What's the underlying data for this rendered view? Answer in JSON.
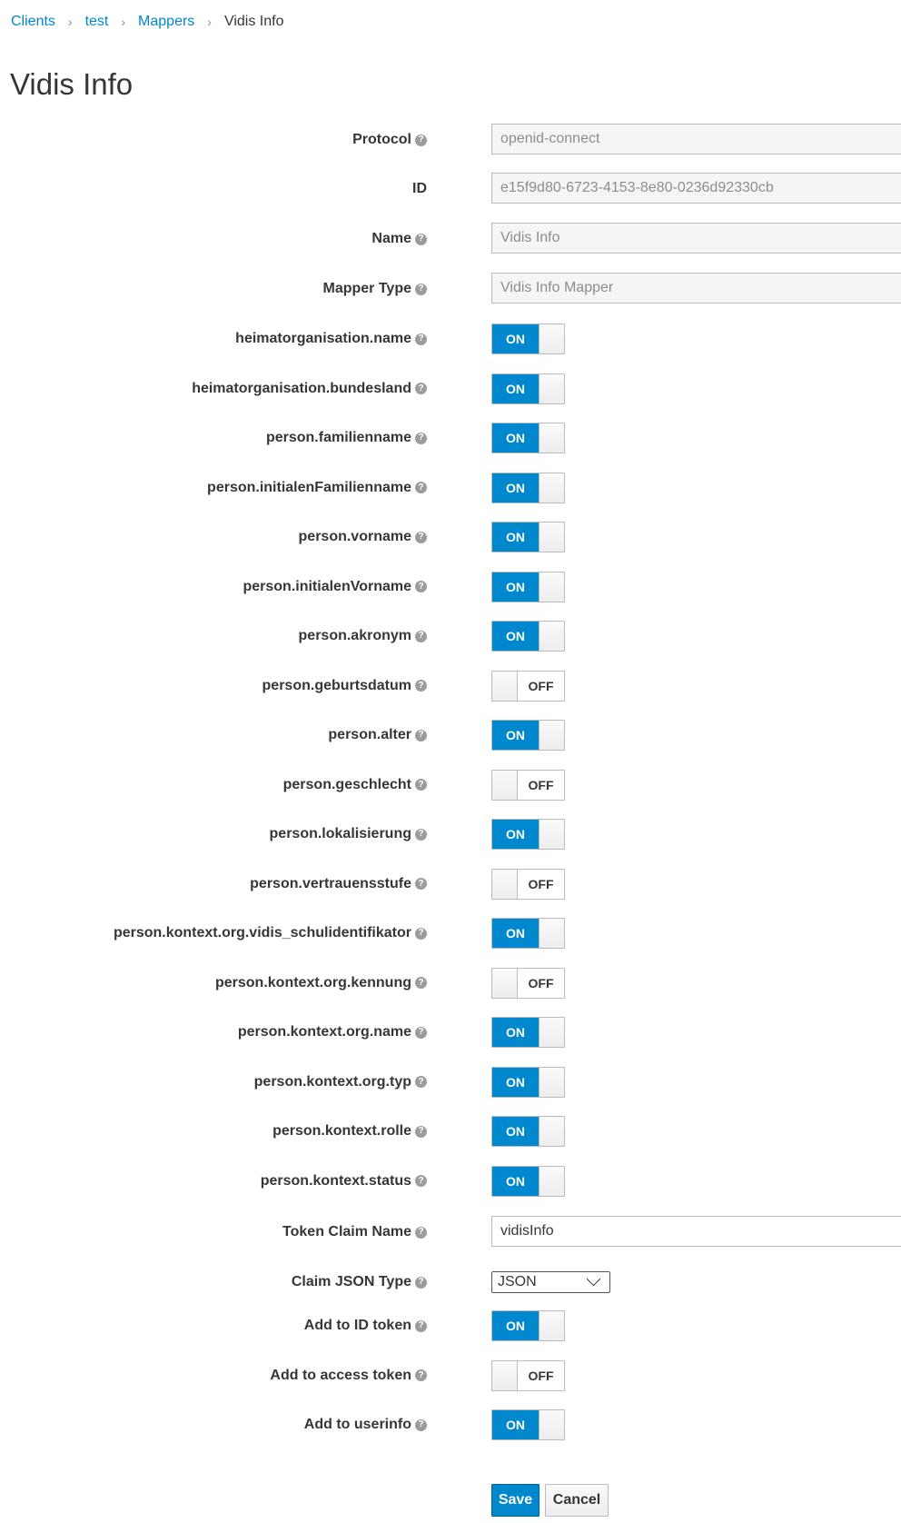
{
  "breadcrumb": {
    "clients": "Clients",
    "test": "test",
    "mappers": "Mappers",
    "current": "Vidis Info",
    "separator": "›"
  },
  "page_title": "Vidis Info",
  "help_glyph": "?",
  "fields": {
    "protocol": {
      "label": "Protocol",
      "value": "openid-connect"
    },
    "id": {
      "label": "ID",
      "value": "e15f9d80-6723-4153-8e80-0236d92330cb"
    },
    "name": {
      "label": "Name",
      "value": "Vidis Info"
    },
    "mapper_type": {
      "label": "Mapper Type",
      "value": "Vidis Info Mapper"
    },
    "token_claim_name": {
      "label": "Token Claim Name",
      "value": "vidisInfo"
    },
    "claim_json_type": {
      "label": "Claim JSON Type",
      "value": "JSON"
    }
  },
  "toggles": [
    {
      "label": "heimatorganisation.name",
      "state": "ON"
    },
    {
      "label": "heimatorganisation.bundesland",
      "state": "ON"
    },
    {
      "label": "person.familienname",
      "state": "ON"
    },
    {
      "label": "person.initialenFamilienname",
      "state": "ON"
    },
    {
      "label": "person.vorname",
      "state": "ON"
    },
    {
      "label": "person.initialenVorname",
      "state": "ON"
    },
    {
      "label": "person.akronym",
      "state": "ON"
    },
    {
      "label": "person.geburtsdatum",
      "state": "OFF"
    },
    {
      "label": "person.alter",
      "state": "ON"
    },
    {
      "label": "person.geschlecht",
      "state": "OFF"
    },
    {
      "label": "person.lokalisierung",
      "state": "ON"
    },
    {
      "label": "person.vertrauensstufe",
      "state": "OFF"
    },
    {
      "label": "person.kontext.org.vidis_schulidentifikator",
      "state": "ON"
    },
    {
      "label": "person.kontext.org.kennung",
      "state": "OFF"
    },
    {
      "label": "person.kontext.org.name",
      "state": "ON"
    },
    {
      "label": "person.kontext.org.typ",
      "state": "ON"
    },
    {
      "label": "person.kontext.rolle",
      "state": "ON"
    },
    {
      "label": "person.kontext.status",
      "state": "ON"
    }
  ],
  "token_toggles": [
    {
      "label": "Add to ID token",
      "state": "ON"
    },
    {
      "label": "Add to access token",
      "state": "OFF"
    },
    {
      "label": "Add to userinfo",
      "state": "ON"
    }
  ],
  "buttons": {
    "save": "Save",
    "cancel": "Cancel"
  },
  "colors": {
    "link": "#0088ce",
    "toggle_on": "#0088ce",
    "text": "#363636"
  }
}
